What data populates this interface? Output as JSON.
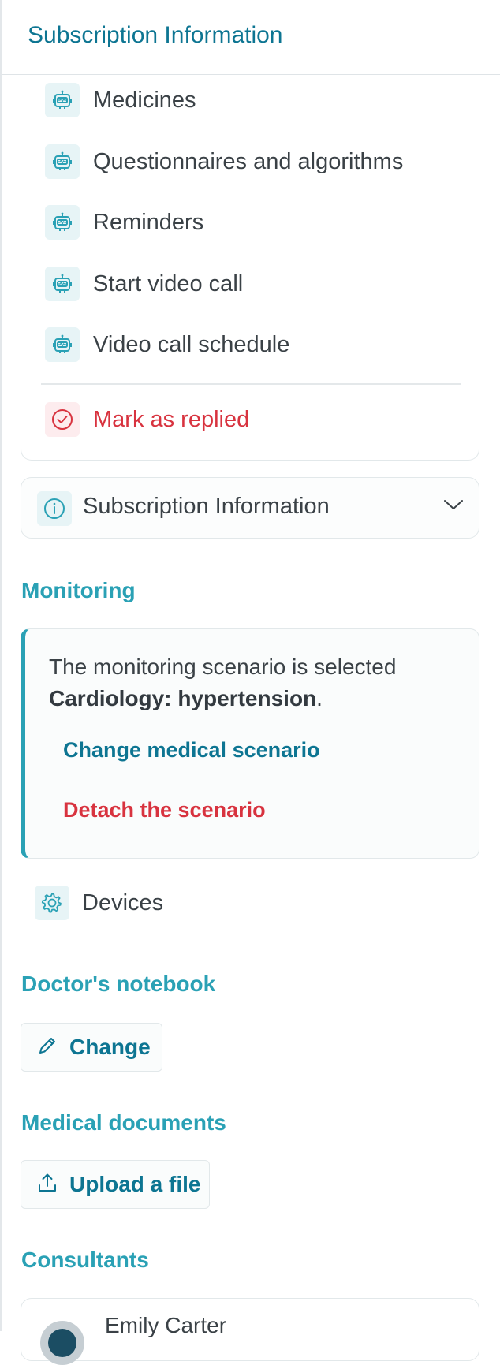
{
  "header": {
    "title": "Subscription Information"
  },
  "menu": {
    "items": [
      {
        "label": "Medicines",
        "icon": "robot-icon"
      },
      {
        "label": "Questionnaires and algorithms",
        "icon": "robot-icon"
      },
      {
        "label": "Reminders",
        "icon": "robot-icon"
      },
      {
        "label": "Start video call",
        "icon": "robot-icon"
      },
      {
        "label": "Video call schedule",
        "icon": "robot-icon"
      }
    ],
    "mark_replied": {
      "label": "Mark as replied",
      "icon": "check-circle-icon"
    }
  },
  "subscription_accordion": {
    "label": "Subscription Information",
    "icon": "info-icon",
    "expanded": false
  },
  "monitoring": {
    "title": "Monitoring",
    "scenario_text": "The monitoring scenario is selected",
    "scenario_name": "Cardiology: hypertension",
    "scenario_suffix": ".",
    "change_link": "Change medical scenario",
    "detach_link": "Detach the scenario",
    "devices_label": "Devices"
  },
  "notebook": {
    "title": "Doctor's notebook",
    "change_label": "Change"
  },
  "documents": {
    "title": "Medical documents",
    "upload_label": "Upload a file"
  },
  "consultants": {
    "title": "Consultants",
    "items": [
      {
        "name": "Emily Carter"
      }
    ]
  },
  "colors": {
    "primary": "#0d7592",
    "accent": "#2aa1b5",
    "danger": "#d8333f",
    "icon_bg": "#e7f4f6"
  }
}
